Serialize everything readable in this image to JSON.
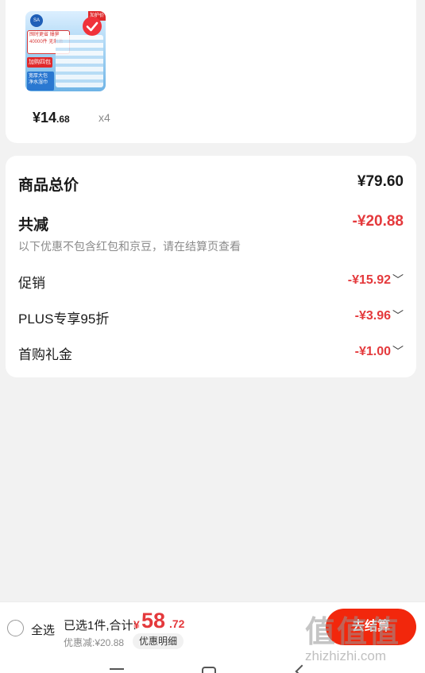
{
  "product": {
    "thumb": {
      "logo_text": "SA",
      "promo_text": "囤时更省 爆量40000件 无刺激",
      "tag_red": "加购四包",
      "tag_blue": "宽厚大包 净水湿巾",
      "corner_text": "加护价"
    },
    "price_int": "¥14",
    "price_dec": ".68",
    "quantity": "x4"
  },
  "summary": {
    "total_label": "商品总价",
    "total_value": "¥79.60",
    "discount_label": "共减",
    "discount_value": "-¥20.88",
    "discount_note": "以下优惠不包含红包和京豆，请在结算页查看",
    "items": [
      {
        "label": "促销",
        "value": "-¥15.92"
      },
      {
        "label": "PLUS专享95折",
        "value": "-¥3.96"
      },
      {
        "label": "首购礼金",
        "value": "-¥1.00"
      }
    ]
  },
  "bottom_bar": {
    "select_all": "全选",
    "selected_text": "已选1件,合计:",
    "currency": "¥",
    "total_int": "58",
    "total_dec": ".72",
    "saved_text": "优惠减:¥20.88",
    "detail_button": "优惠明细",
    "checkout_button": "去结算"
  },
  "watermark": {
    "logo": "值值值",
    "url": "zhizhizhi.com"
  },
  "colors": {
    "accent_red": "#e4393c",
    "checkout_red": "#f2270c",
    "background": "#f2f2f2"
  }
}
